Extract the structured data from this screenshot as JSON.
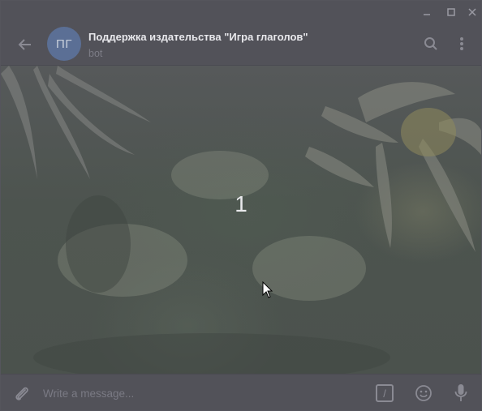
{
  "window": {
    "controls": [
      "minimize-icon",
      "maximize-icon",
      "close-icon"
    ]
  },
  "header": {
    "avatar_initials": "ПГ",
    "avatar_color": "#5b6f95",
    "title": "Поддержка издательства \"Игра глаголов\"",
    "status": "bot",
    "icons": [
      "back-arrow-icon",
      "search-icon",
      "more-vertical-icon"
    ]
  },
  "chat": {
    "center_text": "1"
  },
  "composer": {
    "placeholder": "Write a message...",
    "value": "",
    "command_label": "/",
    "icons": [
      "paperclip-icon",
      "bot-command-icon",
      "emoji-icon",
      "microphone-icon"
    ]
  },
  "colors": {
    "panel": "#525259",
    "icon": "#8a8a93",
    "title_text": "#e8e8ec"
  }
}
